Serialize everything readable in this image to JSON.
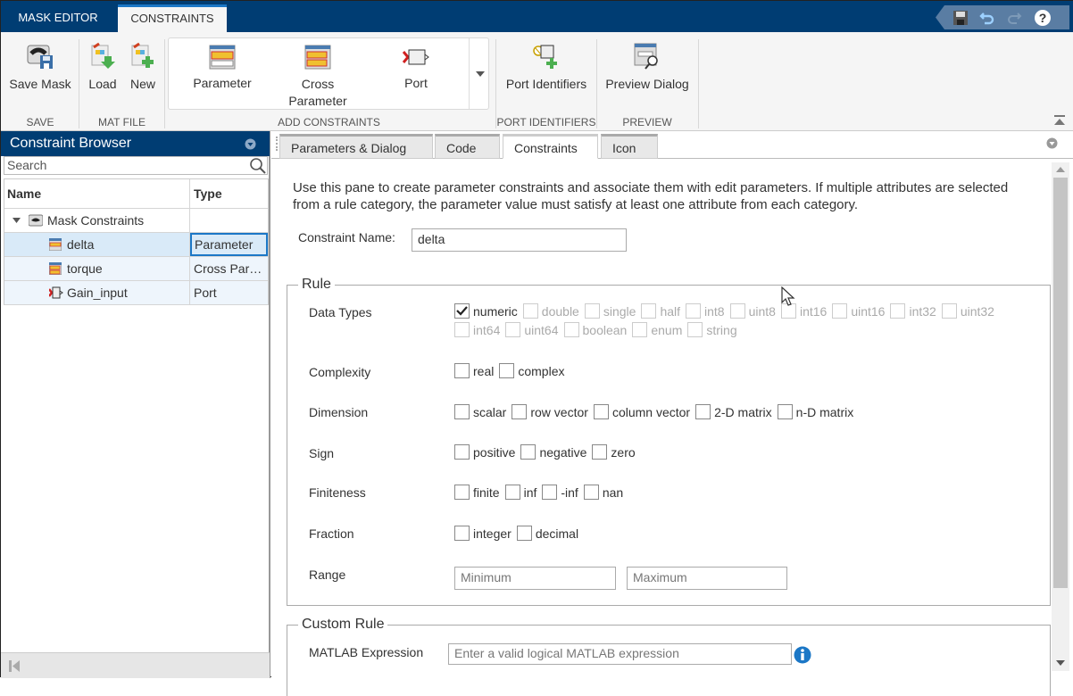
{
  "top_tabs": [
    {
      "label": "MASK EDITOR",
      "active": false
    },
    {
      "label": "CONSTRAINTS",
      "active": true
    }
  ],
  "quick_access": {
    "icons": [
      "save-icon",
      "undo-icon",
      "redo-icon",
      "help-icon"
    ]
  },
  "ribbon": {
    "save_mask": "Save Mask",
    "load": "Load",
    "new": "New",
    "parameter": "Parameter",
    "cross_parameter_1": "Cross",
    "cross_parameter_2": "Parameter",
    "port": "Port",
    "port_identifiers": "Port Identifiers",
    "preview_dialog": "Preview Dialog",
    "sections": {
      "save": "SAVE",
      "mat_file": "MAT FILE",
      "add_constraints": "ADD CONSTRAINTS",
      "port_identifiers": "PORT IDENTIFIERS",
      "preview": "PREVIEW"
    }
  },
  "browser": {
    "title": "Constraint Browser",
    "search_placeholder": "Search",
    "col_name": "Name",
    "col_type": "Type",
    "root": "Mask Constraints",
    "rows": [
      {
        "name": "delta",
        "type": "Parameter",
        "icon": "parameter-icon",
        "selected": true
      },
      {
        "name": "torque",
        "type": "Cross Par…",
        "icon": "cross-parameter-icon",
        "selected": false
      },
      {
        "name": "Gain_input",
        "type": "Port",
        "icon": "port-icon",
        "selected": false
      }
    ]
  },
  "inner_tabs": [
    {
      "label": "Parameters & Dialog",
      "active": false
    },
    {
      "label": "Code",
      "active": false
    },
    {
      "label": "Constraints",
      "active": true
    },
    {
      "label": "Icon",
      "active": false
    }
  ],
  "constraints": {
    "description": "Use this pane to create parameter constraints and associate them with edit parameters. If multiple attributes are selected from a rule category, the parameter value must satisfy at least one attribute from each category.",
    "name_label": "Constraint Name:",
    "name_value": "delta",
    "rule_legend": "Rule",
    "data_types_label": "Data Types",
    "data_types": [
      {
        "label": "numeric",
        "checked": true,
        "enabled": true
      },
      {
        "label": "double",
        "checked": false,
        "enabled": false
      },
      {
        "label": "single",
        "checked": false,
        "enabled": false
      },
      {
        "label": "half",
        "checked": false,
        "enabled": false
      },
      {
        "label": "int8",
        "checked": false,
        "enabled": false
      },
      {
        "label": "uint8",
        "checked": false,
        "enabled": false
      },
      {
        "label": "int16",
        "checked": false,
        "enabled": false
      },
      {
        "label": "uint16",
        "checked": false,
        "enabled": false
      },
      {
        "label": "int32",
        "checked": false,
        "enabled": false
      },
      {
        "label": "uint32",
        "checked": false,
        "enabled": false
      },
      {
        "label": "int64",
        "checked": false,
        "enabled": false
      },
      {
        "label": "uint64",
        "checked": false,
        "enabled": false
      },
      {
        "label": "boolean",
        "checked": false,
        "enabled": false
      },
      {
        "label": "enum",
        "checked": false,
        "enabled": false
      },
      {
        "label": "string",
        "checked": false,
        "enabled": false
      }
    ],
    "complexity_label": "Complexity",
    "complexity": [
      "real",
      "complex"
    ],
    "dimension_label": "Dimension",
    "dimension": [
      "scalar",
      "row vector",
      "column vector",
      "2-D matrix",
      "n-D matrix"
    ],
    "sign_label": "Sign",
    "sign": [
      "positive",
      "negative",
      "zero"
    ],
    "finiteness_label": "Finiteness",
    "finiteness": [
      "finite",
      "inf",
      "-inf",
      "nan"
    ],
    "fraction_label": "Fraction",
    "fraction": [
      "integer",
      "decimal"
    ],
    "range_label": "Range",
    "range_min_placeholder": "Minimum",
    "range_max_placeholder": "Maximum",
    "custom_legend": "Custom Rule",
    "matlab_label": "MATLAB Expression",
    "matlab_placeholder": "Enter a valid logical MATLAB expression"
  }
}
